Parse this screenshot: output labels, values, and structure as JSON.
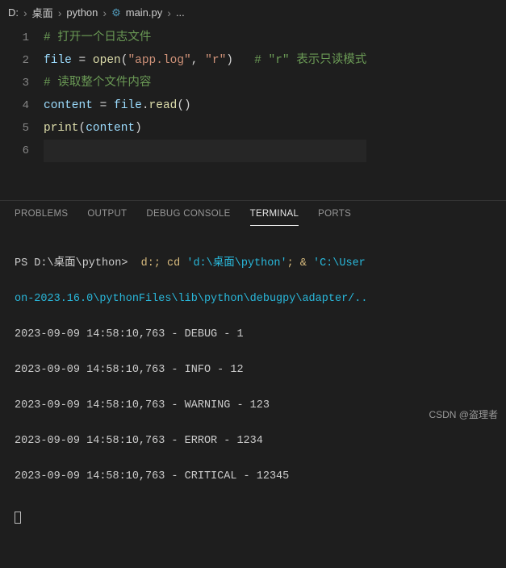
{
  "breadcrumb": {
    "drive": "D:",
    "folder1": "桌面",
    "folder2": "python",
    "file": "main.py",
    "more": "..."
  },
  "gutter": {
    "l1": "1",
    "l2": "2",
    "l3": "3",
    "l4": "4",
    "l5": "5",
    "l6": "6"
  },
  "code": {
    "c1": "# 打开一个日志文件",
    "l2_id1": "file",
    "l2_eq": " = ",
    "l2_fn": "open",
    "l2_p1": "(",
    "l2_s1": "\"app.log\"",
    "l2_cm": ", ",
    "l2_s2": "\"r\"",
    "l2_p2": ")",
    "l2_sp": "   ",
    "l2_cmt": "# \"r\" 表示只读模式",
    "c3": "# 读取整个文件内容",
    "l4_id1": "content",
    "l4_eq": " = ",
    "l4_id2": "file",
    "l4_dot": ".",
    "l4_fn": "read",
    "l4_p": "()",
    "l5_fn": "print",
    "l5_p1": "(",
    "l5_id": "content",
    "l5_p2": ")"
  },
  "tabs": {
    "problems": "PROBLEMS",
    "output": "OUTPUT",
    "debug": "DEBUG CONSOLE",
    "terminal": "TERMINAL",
    "ports": "PORTS"
  },
  "terminal": {
    "prompt": "PS D:\\桌面\\python> ",
    "cmd1": " d:; cd ",
    "path1": "'d:\\桌面\\python'",
    "cmd2": "; & ",
    "path2": "'C:\\User",
    "cont": "on-2023.16.0\\pythonFiles\\lib\\python\\debugpy\\adapter/..",
    "o1": "2023-09-09 14:58:10,763 - DEBUG - 1",
    "o2": "2023-09-09 14:58:10,763 - INFO - 12",
    "o3": "2023-09-09 14:58:10,763 - WARNING - 123",
    "o4": "2023-09-09 14:58:10,763 - ERROR - 1234",
    "o5": "2023-09-09 14:58:10,763 - CRITICAL - 12345"
  },
  "watermark": "CSDN @盗理者"
}
